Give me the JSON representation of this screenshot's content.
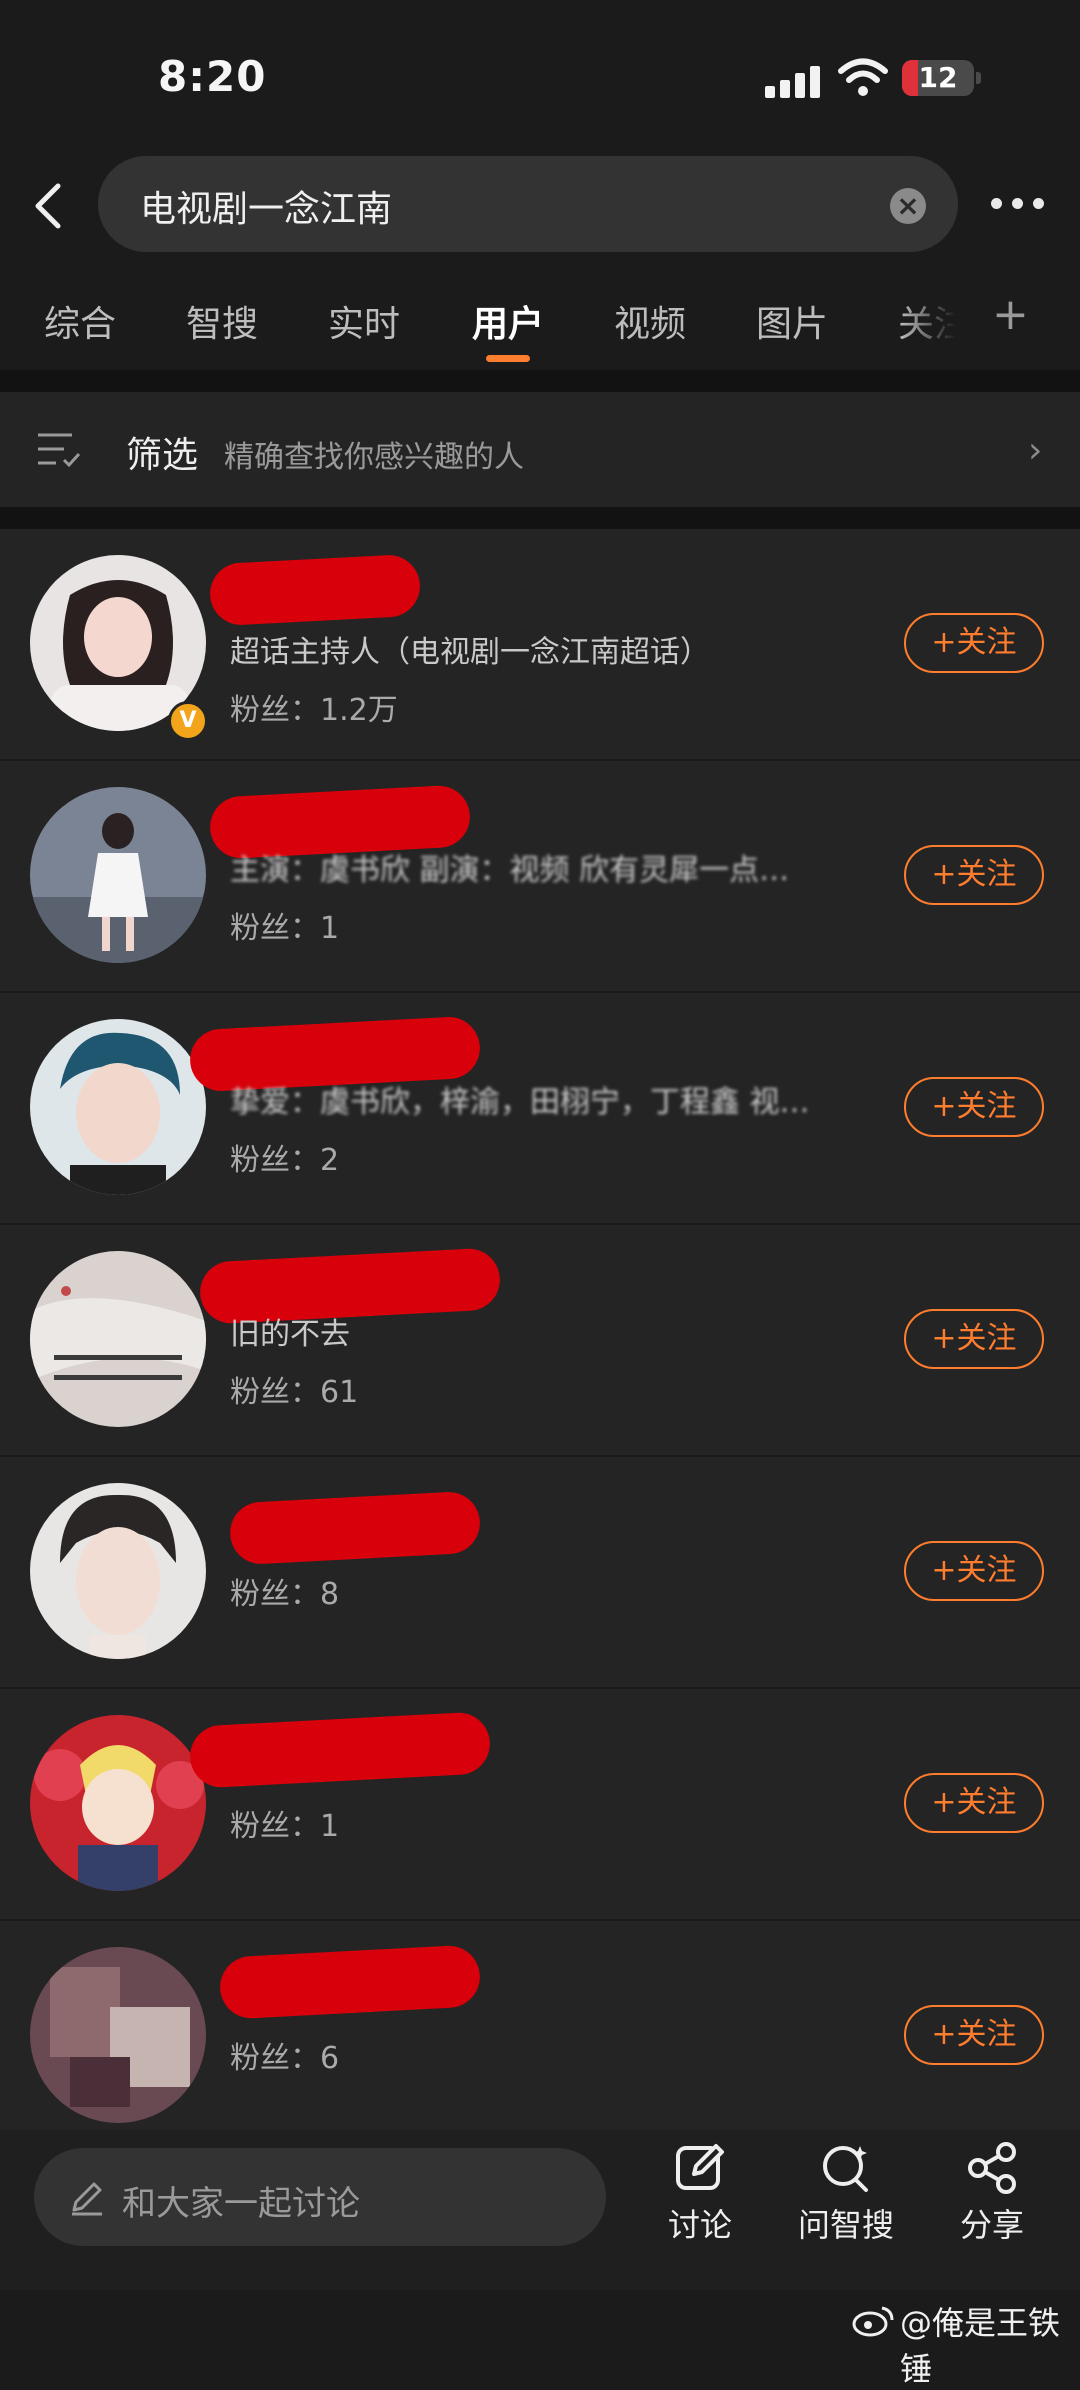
{
  "status": {
    "time": "8:20",
    "battery": "12"
  },
  "search": {
    "query": "电视剧一念江南"
  },
  "tabs": [
    "综合",
    "智搜",
    "实时",
    "用户",
    "视频",
    "图片",
    "关注"
  ],
  "active_tab": "用户",
  "filter": {
    "title": "筛选",
    "subtitle": "精确查找你感兴趣的人",
    "chevron": "›"
  },
  "users": [
    {
      "bio": "超话主持人（电视剧一念江南超话）",
      "fans": "粉丝：1.2万",
      "follow": "+关注",
      "verified": true
    },
    {
      "bio": "主演：虞书欣 副演：视频 欣有灵犀一点…",
      "fans": "粉丝：1",
      "follow": "+关注"
    },
    {
      "bio": "挚爱：虞书欣，梓渝，田栩宁，丁程鑫 视…",
      "fans": "粉丝：2",
      "follow": "+关注"
    },
    {
      "bio": "旧的不去",
      "fans": "粉丝：61",
      "follow": "+关注"
    },
    {
      "bio": "",
      "fans": "粉丝：8",
      "follow": "+关注"
    },
    {
      "bio": "",
      "fans": "粉丝：1",
      "follow": "+关注"
    },
    {
      "bio": "",
      "fans": "粉丝：6",
      "follow": "+关注"
    }
  ],
  "bottom": {
    "placeholder": "和大家一起讨论",
    "actions": {
      "discuss": "讨论",
      "ask": "问智搜",
      "share": "分享"
    }
  },
  "watermark": "@俺是王铁锤",
  "colors": {
    "accent": "#ff7d2e",
    "background": "#1b1b1b",
    "card": "#242424",
    "redact": "#d8000a"
  }
}
